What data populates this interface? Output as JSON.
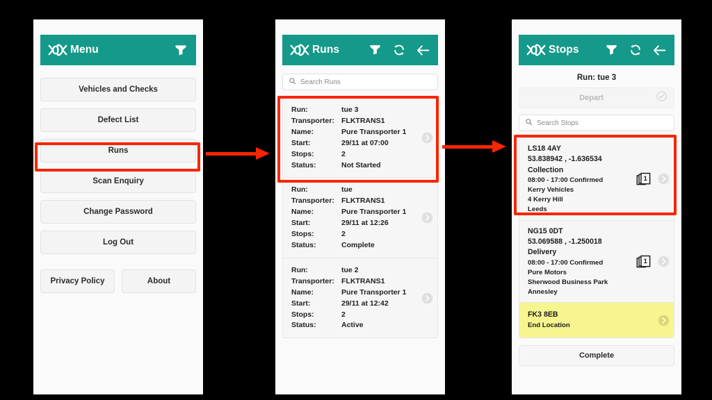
{
  "theme": {
    "brand_teal": "#15998a",
    "highlight_red": "#f92500",
    "end_location_yellow": "#f7f58f",
    "panel_bg": "#fafafa"
  },
  "panels": {
    "menu": {
      "appbar": {
        "title": "Menu",
        "logo_icon": "route-loop-logo-icon",
        "icons": [
          "filter-icon"
        ]
      },
      "items": [
        {
          "label": "Vehicles and Checks"
        },
        {
          "label": "Defect List"
        },
        {
          "label": "Runs"
        },
        {
          "label": "Scan Enquiry"
        },
        {
          "label": "Change Password"
        },
        {
          "label": "Log Out"
        }
      ],
      "footer": [
        {
          "label": "Privacy Policy"
        },
        {
          "label": "About"
        }
      ]
    },
    "runs": {
      "appbar": {
        "title": "Runs",
        "logo_icon": "route-loop-logo-icon",
        "icons": [
          "filter-icon",
          "refresh-icon",
          "back-arrow-icon"
        ]
      },
      "search": {
        "placeholder": "Search Runs",
        "value": "",
        "icon": "search-icon"
      },
      "field_labels": {
        "run": "Run:",
        "transporter": "Transporter:",
        "name": "Name:",
        "start": "Start:",
        "stops": "Stops:",
        "status": "Status:"
      },
      "cards": [
        {
          "run": "tue 3",
          "transporter": "FLKTRANS1",
          "name": "Pure Transporter 1",
          "start": "29/11 at 07:00",
          "stops": "2",
          "status": "Not Started"
        },
        {
          "run": "tue",
          "transporter": "FLKTRANS1",
          "name": "Pure Transporter 1",
          "start": "29/11 at 12:26",
          "stops": "2",
          "status": "Complete"
        },
        {
          "run": "tue 2",
          "transporter": "FLKTRANS1",
          "name": "Pure Transporter 1",
          "start": "29/11 at 12:42",
          "stops": "2",
          "status": "Active"
        }
      ]
    },
    "stops": {
      "appbar": {
        "title": "Stops",
        "logo_icon": "route-loop-logo-icon",
        "icons": [
          "filter-icon",
          "refresh-icon",
          "back-arrow-icon"
        ]
      },
      "run_title": "Run: tue 3",
      "depart_button": {
        "label": "Depart",
        "icon": "check-circle-icon",
        "disabled": true
      },
      "search": {
        "placeholder": "Search Stops",
        "value": "",
        "icon": "search-icon"
      },
      "cards": [
        {
          "postcode": "LS18 4AY",
          "coords": "53.838942 , -1.636534",
          "type": "Collection",
          "window": "08:00 - 17:00 Confirmed",
          "company": "Kerry Vehicles",
          "address1": "4 Kerry Hill",
          "address2": "Leeds",
          "badge_count": "1",
          "badge_icon": "stacked-items-icon"
        },
        {
          "postcode": "NG15 0DT",
          "coords": "53.069588 , -1.250018",
          "type": "Delivery",
          "window": "08:00 - 17:00 Confirmed",
          "company": "Pure Motors",
          "address1": "Sherwood Business Park",
          "address2": "Annesley",
          "badge_count": "1",
          "badge_icon": "stacked-items-icon"
        }
      ],
      "end_card": {
        "postcode": "FK3 8EB",
        "label": "End Location"
      },
      "complete_button": {
        "label": "Complete"
      }
    }
  }
}
